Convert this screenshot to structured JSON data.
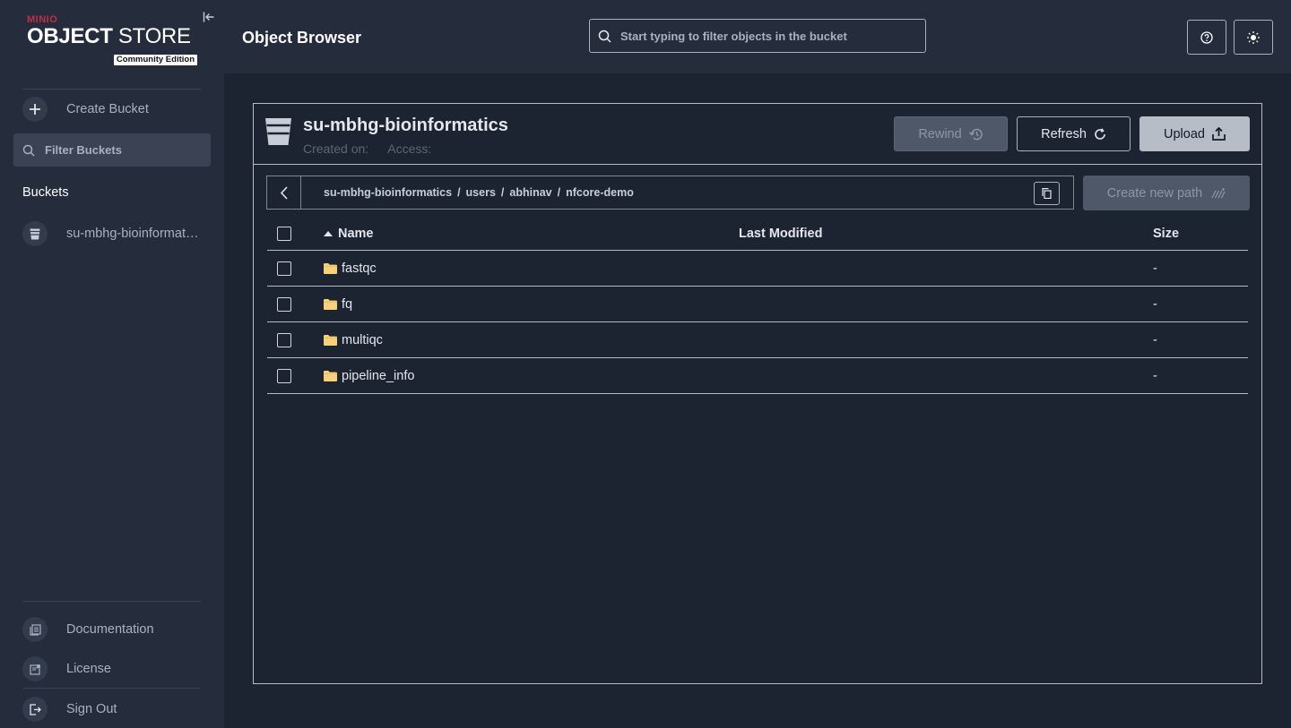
{
  "logo": {
    "brand": "MINIO",
    "product_bold": "OBJECT",
    "product_rest": " STORE",
    "edition": "Community Edition"
  },
  "sidebar": {
    "create_bucket": "Create Bucket",
    "filter_placeholder": "Filter Buckets",
    "buckets_heading": "Buckets",
    "buckets": [
      {
        "label": "su-mbhg-bioinformatics"
      }
    ],
    "footer_items": [
      {
        "label": "Documentation",
        "icon": "documentation-icon"
      },
      {
        "label": "License",
        "icon": "license-icon"
      },
      {
        "label": "Sign Out",
        "icon": "sign-out-icon"
      }
    ]
  },
  "header": {
    "title": "Object Browser",
    "search_placeholder": "Start typing to filter objects in the bucket"
  },
  "bucket": {
    "name": "su-mbhg-bioinformatics",
    "created_on_label": "Created on:",
    "access_label": "Access:",
    "rewind_label": "Rewind",
    "refresh_label": "Refresh",
    "upload_label": "Upload"
  },
  "breadcrumb": {
    "parts": [
      "su-mbhg-bioinformatics",
      "users",
      "abhinav",
      "nfcore-demo"
    ],
    "separator": "/"
  },
  "create_path_label": "Create new path",
  "table": {
    "columns": {
      "name": "Name",
      "modified": "Last Modified",
      "size": "Size"
    },
    "rows": [
      {
        "name": "fastqc",
        "modified": "",
        "size": "-"
      },
      {
        "name": "fq",
        "modified": "",
        "size": "-"
      },
      {
        "name": "multiqc",
        "modified": "",
        "size": "-"
      },
      {
        "name": "pipeline_info",
        "modified": "",
        "size": "-"
      }
    ]
  },
  "colors": {
    "background": "#1c2331",
    "panel": "#252d3c",
    "brand_red": "#c72c48",
    "folder": "#f5d27a"
  }
}
